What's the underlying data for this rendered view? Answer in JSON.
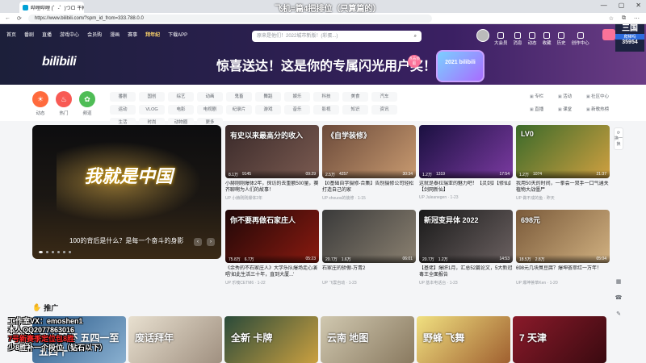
{
  "browser": {
    "tab_title": "哔哩哔哩 (゜-゜)つロ 干杯~-bili",
    "url": "https://www.bilibili.com/?spm_id_from=333.788.0.0"
  },
  "stream_title": "飞机=篇4把排位（只算篇的）",
  "header": {
    "nav": [
      "首页",
      "番剧",
      "直播",
      "游戏中心",
      "会员购",
      "漫画",
      "赛事",
      "拜年纪",
      "下载APP"
    ],
    "search_placeholder": "原来是他们！2022城市新版！(彩蛋...)",
    "right": [
      "大会员",
      "消息",
      "动态",
      "收藏",
      "历史",
      "创作中心"
    ],
    "logo": "bilibili",
    "slogan": "惊喜送达！这是你的专属闪光用户奖！",
    "slogan_badge": "点击领取",
    "trophy_text": "2021 bilibili"
  },
  "live_overlay": {
    "title": "三国",
    "sub": "爬梯吗",
    "count": "35954"
  },
  "channels": {
    "circles": [
      {
        "label": "动态",
        "color": "#ff6a3d"
      },
      {
        "label": "热门",
        "color": "#f85a54"
      },
      {
        "label": "频道",
        "color": "#4fbd56"
      }
    ],
    "chips": [
      "番剧",
      "国创",
      "综艺",
      "动画",
      "鬼畜",
      "舞蹈",
      "娱乐",
      "科技",
      "美食",
      "汽车",
      "运动",
      "VLOG",
      "电影",
      "电视剧",
      "纪录片",
      "游戏",
      "音乐",
      "影视",
      "知识",
      "资讯",
      "生活",
      "时尚",
      "动物圈",
      "更多"
    ],
    "side": [
      "专栏",
      "活动",
      "社区中心",
      "直播",
      "课堂",
      "新歌热榜"
    ]
  },
  "carousel": {
    "big_text": "我就是中国",
    "caption": "100的背后是什么？是每一个奋斗的身影"
  },
  "videos": [
    {
      "title": "小赫刚刚爆体2年，探访的去重额500量，赛齐聊啊为人们的故事！",
      "up": "小赫刚刚爆体2年",
      "views": "8.1万",
      "likes": "9145",
      "dur": "09:29",
      "overlay": "有史以来最高分的收入"
    },
    {
      "title": "【0基础自学摄修-合集】告别摄修公司轻松打造自己的家",
      "up": "xhouos的装修 · 1-15",
      "views": "2.5万",
      "likes": "4257",
      "dur": "30:34",
      "overlay": "《自学装修》"
    },
    {
      "title": "这就是泰拉瑞亚的魅力吧！【灵剑】【修仙】【剑网新仙】",
      "up": "Juleanegen · 1-23",
      "views": "1.2万",
      "likes": "1319",
      "dur": "17:54",
      "overlay": ""
    },
    {
      "title": "我用50天的时间，一拳会一双手一口气通关植物大战僵尸",
      "up": "做不成的鱼 · 昨天",
      "views": "1.2万",
      "likes": "1074",
      "dur": "21:37",
      "overlay": "LV0"
    },
    {
      "title": "《余秀的不石家庄人》大学乐队爆场走心演唱'如此生活三十年，直到大厦...'",
      "up": "乐噢CETM6 · 1-22",
      "views": "75.8万",
      "likes": "6.7万",
      "dur": "05:23",
      "overlay": "你不要再做石家庄人"
    },
    {
      "title": "石家庄的骄傲-万青2",
      "up": "飞雲自动 · 1-23",
      "views": "20.7万",
      "likes": "1.6万",
      "dur": "06:01",
      "overlay": ""
    },
    {
      "title": "【基佬】爆肝1月，汇总52篇论文，5大新冠毒王全面报告",
      "up": "基本电话台 · 1-23",
      "views": "20.7万",
      "likes": "1.2万",
      "dur": "14:53",
      "overlay": "新冠变异体 2022"
    },
    {
      "title": "698元几块臭豆腐？爆坤荟萃红一万年！",
      "up": "爆坤荟萃Ken · 1-20",
      "views": "18.5万",
      "likes": "2.8万",
      "dur": "05:04",
      "overlay": "698元"
    }
  ],
  "right_tools": {
    "top": "换一换",
    "bottom": [
      "客服",
      "反馈"
    ]
  },
  "promo": {
    "heading": "推广",
    "cards": [
      "周末限杯 五四一至五四十",
      "废话拜年",
      "全新 卡牌",
      "云南 地图",
      "野蜂 飞舞",
      "7 天津"
    ]
  },
  "overlay_lines": [
    "工作室VX：emoshen1",
    "本人QQ2077863016",
    "7号新赛季定位包8胜",
    "少8胜补一个段位（钻石以下）"
  ]
}
